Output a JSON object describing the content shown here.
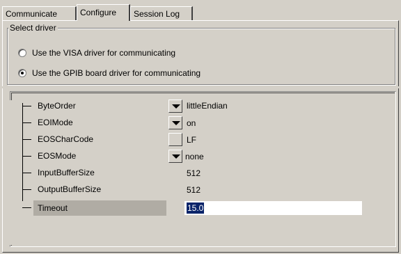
{
  "tabs": [
    {
      "label": "Communicate",
      "active": false
    },
    {
      "label": "Configure",
      "active": true
    },
    {
      "label": "Session Log",
      "active": false
    }
  ],
  "driver_group": {
    "legend": "Select driver",
    "options": [
      {
        "label": "Use the VISA driver for communicating",
        "selected": false
      },
      {
        "label": "Use the GPIB board driver for communicating",
        "selected": true
      }
    ]
  },
  "properties": [
    {
      "name": "ByteOrder",
      "control": "dropdown",
      "value": "littleEndian"
    },
    {
      "name": "EOIMode",
      "control": "dropdown",
      "value": "on"
    },
    {
      "name": "EOSCharCode",
      "control": "button",
      "value": "LF"
    },
    {
      "name": "EOSMode",
      "control": "dropdown",
      "value": "none"
    },
    {
      "name": "InputBufferSize",
      "control": "text",
      "value": "512"
    },
    {
      "name": "OutputBufferSize",
      "control": "text",
      "value": "512"
    },
    {
      "name": "Timeout",
      "control": "edit",
      "value": "15.0",
      "selected": true
    }
  ],
  "colors": {
    "background": "#d4d0c8",
    "selection": "#0a246a",
    "selected_row": "#b0aca4"
  }
}
